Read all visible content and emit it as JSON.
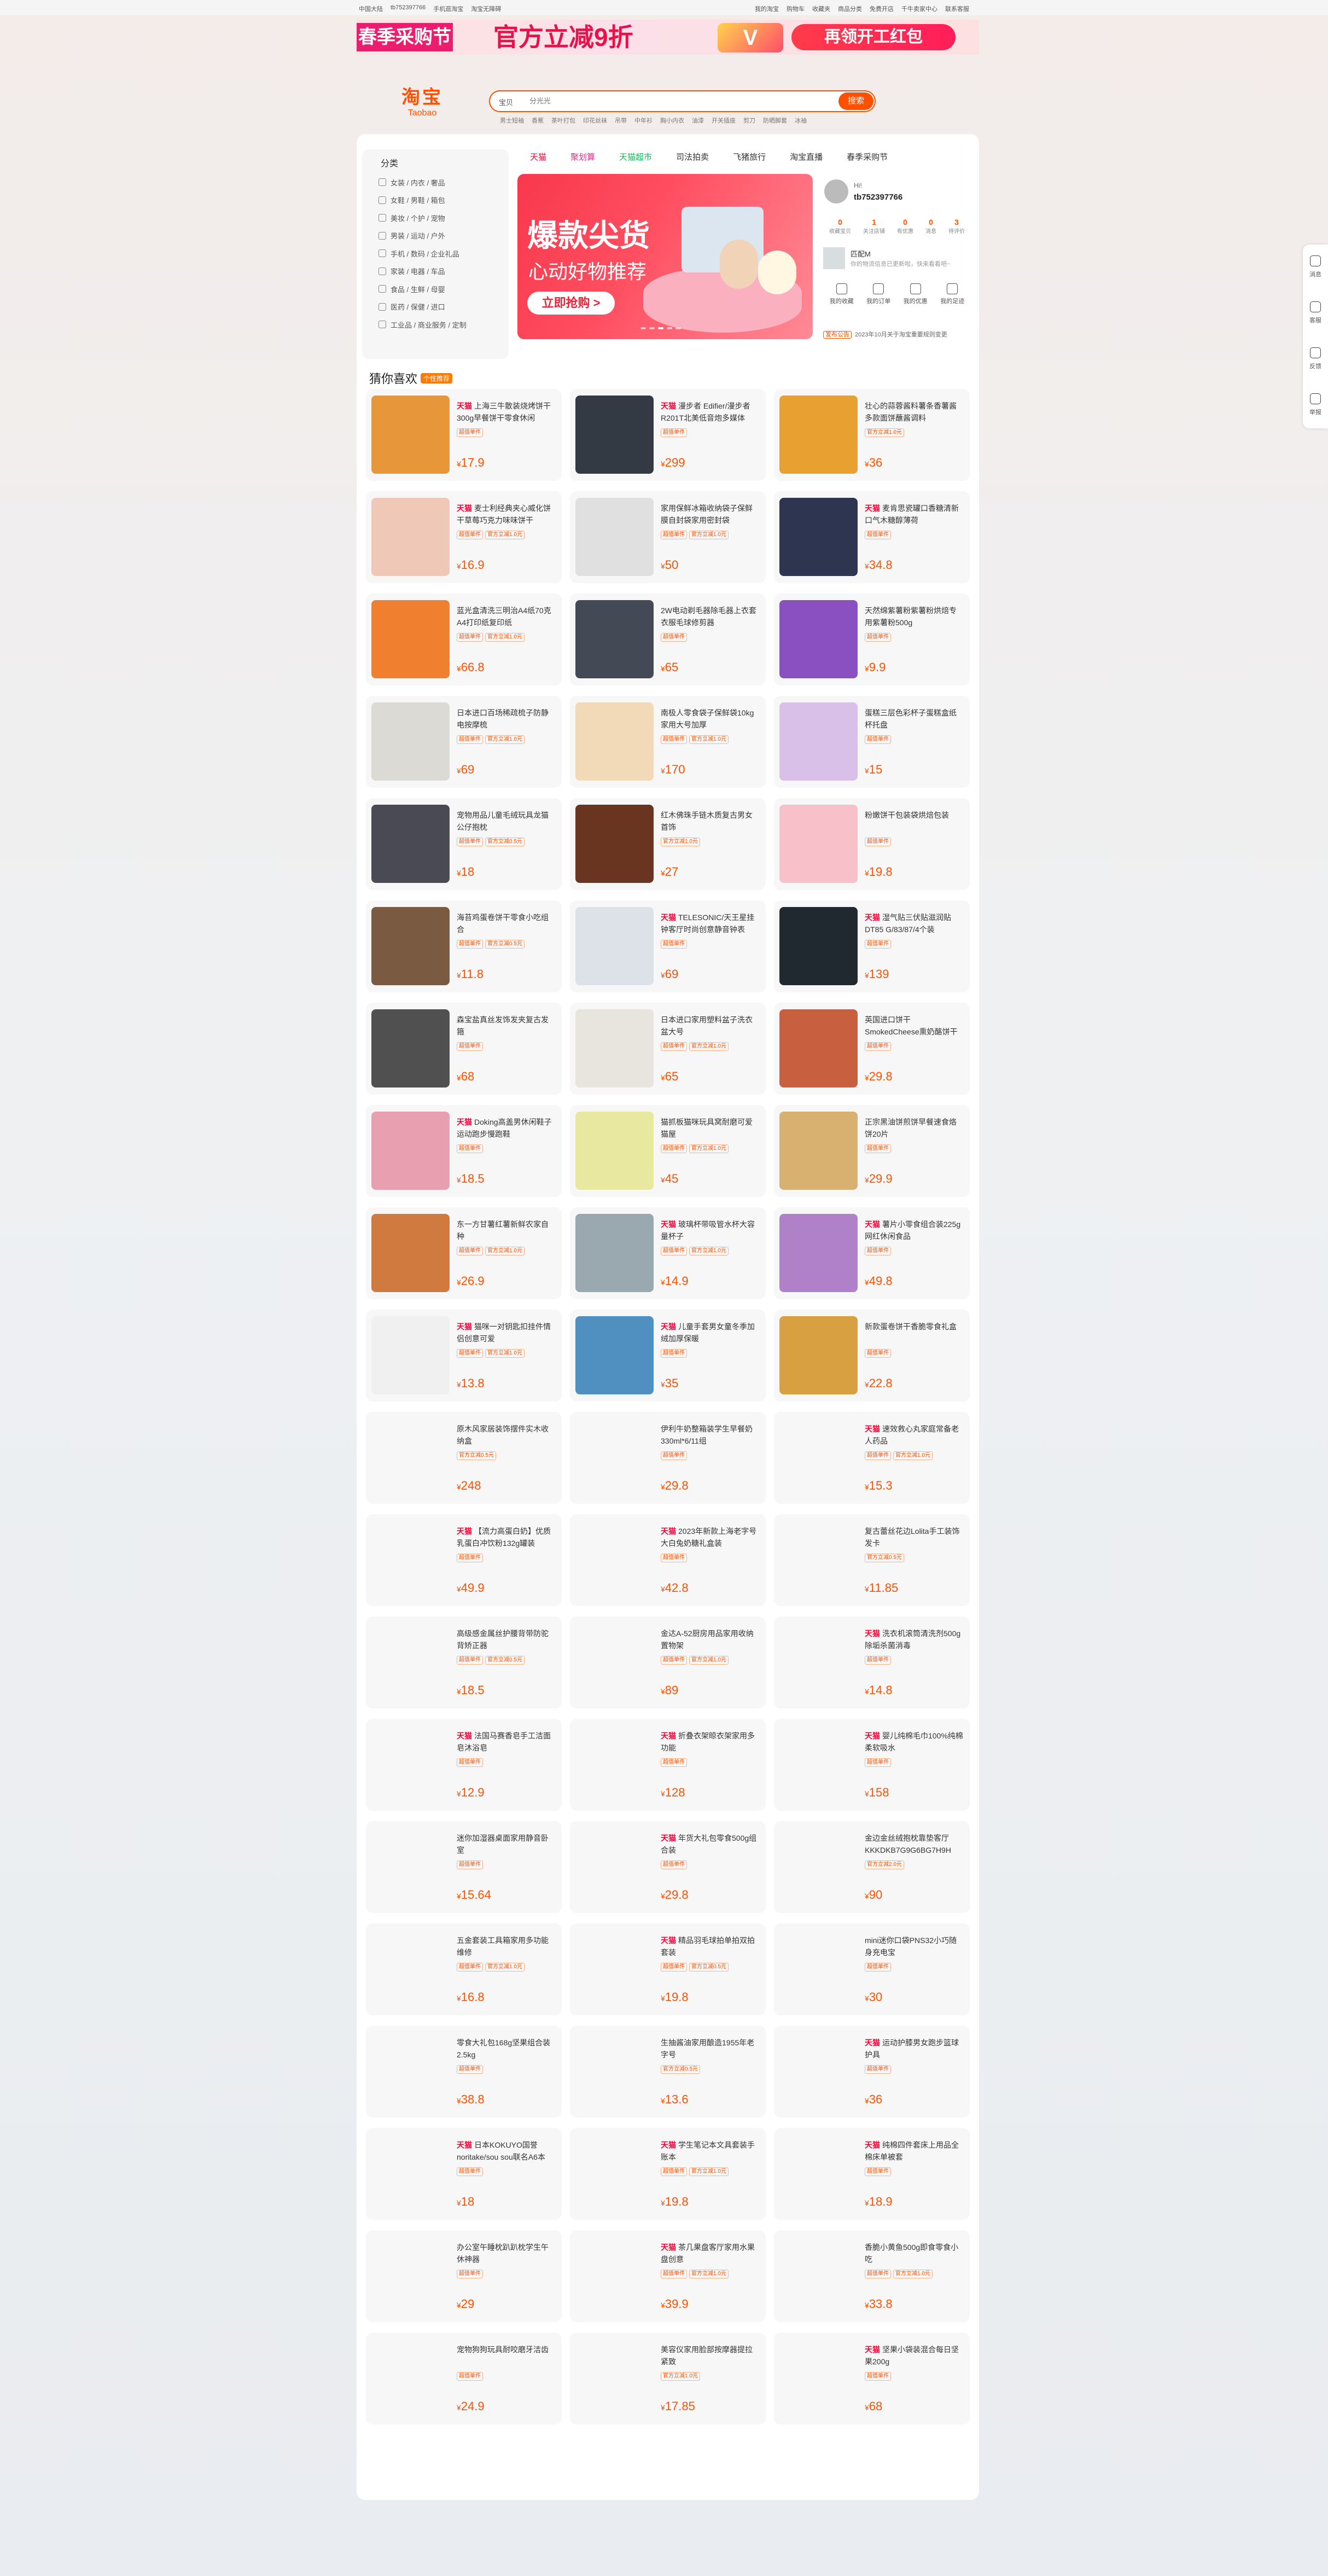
{
  "topbar": {
    "left": [
      "中国大陆",
      "tb752397766",
      "手机逛淘宝",
      "淘宝无障碍"
    ],
    "right": [
      "我的淘宝",
      "购物车",
      "收藏夹",
      "商品分类",
      "免费开店",
      "千牛卖家中心",
      "联系客服"
    ]
  },
  "banner": {
    "left": "春季采购节",
    "center": "官方立减9折",
    "v": "V",
    "cta": "再领开工红包"
  },
  "logo": {
    "main": "淘宝",
    "sub": "Taobao"
  },
  "search": {
    "category": "宝贝",
    "placeholder": "分光光",
    "button": "搜索"
  },
  "hot": [
    "男士短袖",
    "香蕉",
    "茶叶打包",
    "印花丝袜",
    "吊带",
    "中年衫",
    "胸小内衣",
    "油漆",
    "开关插座",
    "剪刀",
    "防晒脚套",
    "冰袖"
  ],
  "categories": {
    "title": "分类",
    "items": [
      "女装 / 内衣 / 奢品",
      "女鞋 / 男鞋 / 箱包",
      "美妆 / 个护 / 宠物",
      "男装 / 运动 / 户外",
      "手机 / 数码 / 企业礼品",
      "家装 / 电器 / 车品",
      "食品 / 生鲜 / 母婴",
      "医药 / 保健 / 进口",
      "工业品 / 商业服务 / 定制"
    ]
  },
  "tabs": [
    {
      "label": "天猫",
      "color": "#ff0036"
    },
    {
      "label": "聚划算",
      "color": "#e02e8a"
    },
    {
      "label": "天猫超市",
      "color": "#19b95d"
    },
    {
      "label": "司法拍卖",
      "color": "#333333"
    },
    {
      "label": "飞猪旅行",
      "color": "#333333"
    },
    {
      "label": "淘宝直播",
      "color": "#333333"
    },
    {
      "label": "春季采购节",
      "color": "#333333"
    }
  ],
  "hero": {
    "title": "爆款尖货",
    "subtitle": "心动好物推荐",
    "cta": "立即抢购 >"
  },
  "user": {
    "hi": "Hi!",
    "name": "tb752397766",
    "stats": [
      {
        "n": "0",
        "l": "收藏宝贝"
      },
      {
        "n": "1",
        "l": "关注店铺"
      },
      {
        "n": "0",
        "l": "有优惠"
      },
      {
        "n": "0",
        "l": "消息"
      },
      {
        "n": "3",
        "l": "待评价"
      }
    ],
    "fav_name": "匹配M",
    "fav_sub": "你的物流信息已更新啦，快来看看吧~",
    "actions": [
      "我的收藏",
      "我的订单",
      "我的优惠",
      "我的足迹"
    ],
    "ann_tag": "发布公告",
    "announcement": "2023年10月关于淘宝重要规则变更"
  },
  "guess": {
    "title": "猜你喜欢",
    "tag": "个性推荐"
  },
  "products": [
    {
      "tm": "天猫",
      "title": "上海三牛散装烧烤饼干300g早餐饼干零食休闲",
      "badges": [
        "超值单件"
      ],
      "price": "17.9",
      "img": "#e8963a"
    },
    {
      "tm": "天猫",
      "title": "漫步者 Edifier/漫步者 R201T北美低音炮多媒体",
      "badges": [
        "超值单件"
      ],
      "price": "299",
      "img": "#333a44"
    },
    {
      "tm": "",
      "title": "壮心的蒜蓉酱料薯条香薯酱多款面饼蘸酱调料",
      "badges": [
        "官方立减1.0元"
      ],
      "price": "36",
      "img": "#e8a030"
    },
    {
      "tm": "天猫",
      "title": "麦士利经典夹心威化饼干草莓巧克力味味饼干",
      "badges": [
        "超值单件",
        "官方立减1.0元"
      ],
      "price": "16.9",
      "img": "#f0c8b8"
    },
    {
      "tm": "",
      "title": "家用保鲜冰箱收纳袋子保鲜膜自封袋家用密封袋",
      "badges": [
        "超值单件",
        "官方立减1.0元"
      ],
      "price": "50",
      "img": "#e0e0e0"
    },
    {
      "tm": "天猫",
      "title": "麦肯思瓷罐口香糖清新口气木糖醇薄荷",
      "badges": [
        "超值单件"
      ],
      "price": "34.8",
      "img": "#2d3550"
    },
    {
      "tm": "",
      "title": "蓝光盒清洗三明治A4纸70克A4打印纸复印纸",
      "badges": [
        "超值单件",
        "官方立减1.0元"
      ],
      "price": "66.8",
      "img": "#f08030"
    },
    {
      "tm": "",
      "title": "2W电动剃毛器除毛器上衣套衣服毛球修剪器",
      "badges": [
        "超值单件"
      ],
      "price": "65",
      "img": "#444a55"
    },
    {
      "tm": "",
      "title": "天然绵紫薯粉紫薯粉烘焙专用紫薯粉500g",
      "badges": [
        "超值单件"
      ],
      "price": "9.9",
      "img": "#8a4fc0"
    },
    {
      "tm": "",
      "title": "日本进口百场稀疏梳子防静电按摩梳",
      "badges": [
        "超值单件",
        "官方立减1.0元"
      ],
      "price": "69",
      "img": "#dcdad5"
    },
    {
      "tm": "",
      "title": "南极人零食袋子保鲜袋10kg家用大号加厚",
      "badges": [
        "超值单件",
        "官方立减1.0元"
      ],
      "price": "170",
      "img": "#f2d9b8"
    },
    {
      "tm": "",
      "title": "蛋糕三层色彩杯子蛋糕盒纸杯托盘",
      "badges": [
        "超值单件"
      ],
      "price": "15",
      "img": "#d8c0e8"
    },
    {
      "tm": "",
      "title": "宠物用品儿童毛绒玩具龙猫公仔抱枕",
      "badges": [
        "超值单件",
        "官方立减0.5元"
      ],
      "price": "18",
      "img": "#4a4a55"
    },
    {
      "tm": "",
      "title": "红木佛珠手链木质复古男女首饰",
      "badges": [
        "官方立减1.0元"
      ],
      "price": "27",
      "img": "#6a3520"
    },
    {
      "tm": "",
      "title": "粉嫩饼干包装袋烘焙包装",
      "badges": [
        "超值单件"
      ],
      "price": "19.8",
      "img": "#f8c0c8"
    },
    {
      "tm": "",
      "title": "海苔鸡蛋卷饼干零食小吃组合",
      "badges": [
        "超值单件",
        "官方立减0.5元"
      ],
      "price": "11.8",
      "img": "#7a5a40"
    },
    {
      "tm": "天猫",
      "title": "TELESONIC/天王星挂钟客厅时尚创意静音钟表",
      "badges": [
        "超值单件"
      ],
      "price": "69",
      "img": "#dde2e8"
    },
    {
      "tm": "天猫",
      "title": "湿气贴三伏贴滋润贴DT85 G/83/87/4个装",
      "badges": [
        "超值单件"
      ],
      "price": "139",
      "img": "#202830"
    },
    {
      "tm": "",
      "title": "森宝盐真丝发饰发夹复古发箍",
      "badges": [
        "超值单件"
      ],
      "price": "68",
      "img": "#505050"
    },
    {
      "tm": "",
      "title": "日本进口家用塑料盆子洗衣盆大号",
      "badges": [
        "超值单件",
        "官方立减1.0元"
      ],
      "price": "65",
      "img": "#e8e4de"
    },
    {
      "tm": "",
      "title": "英国进口饼干SmokedCheese熏奶酪饼干",
      "badges": [
        "超值单件"
      ],
      "price": "29.8",
      "img": "#c86040"
    },
    {
      "tm": "天猫",
      "title": "Doking高盖男休闲鞋子运动跑步慢跑鞋",
      "badges": [
        "超值单件"
      ],
      "price": "18.5",
      "img": "#e8a0b0"
    },
    {
      "tm": "",
      "title": "猫抓板猫咪玩具窝耐磨可爱猫屋",
      "badges": [
        "超值单件",
        "官方立减1.0元"
      ],
      "price": "45",
      "img": "#e8e8a0"
    },
    {
      "tm": "",
      "title": "正宗黑油饼煎饼早餐速食烙饼20片",
      "badges": [
        "超值单件"
      ],
      "price": "29.9",
      "img": "#d8b070"
    },
    {
      "tm": "",
      "title": "东一方甘薯红薯新鲜农家自种",
      "badges": [
        "超值单件",
        "官方立减1.0元"
      ],
      "price": "26.9",
      "img": "#d07a40"
    },
    {
      "tm": "天猫",
      "title": "玻璃杯带吸管水杯大容量杯子",
      "badges": [
        "超值单件",
        "官方立减1.0元"
      ],
      "price": "14.9",
      "img": "#9aa8b0"
    },
    {
      "tm": "天猫",
      "title": "薯片小零食组合装225g网红休闲食品",
      "badges": [
        "超值单件"
      ],
      "price": "49.8",
      "img": "#b080c8"
    },
    {
      "tm": "天猫",
      "title": "猫咪一对钥匙扣挂件情侣创意可爱",
      "badges": [
        "超值单件",
        "官方立减1.0元"
      ],
      "price": "13.8",
      "img": "#f0f0f0"
    },
    {
      "tm": "天猫",
      "title": "儿童手套男女童冬季加绒加厚保暖",
      "badges": [
        "超值单件"
      ],
      "price": "35",
      "img": "#5090c0"
    },
    {
      "tm": "",
      "title": "新款蛋卷饼干香脆零食礼盒",
      "badges": [
        "超值单件"
      ],
      "price": "22.8",
      "img": "#d8a040"
    },
    {
      "tm": "",
      "title": "原木风家居装饰摆件实木收纳盒",
      "badges": [
        "官方立减0.5元"
      ],
      "price": "248",
      "img": "#f7f7f7"
    },
    {
      "tm": "",
      "title": "伊利牛奶整箱装学生早餐奶330ml*6/11组",
      "badges": [
        "超值单件"
      ],
      "price": "29.8",
      "img": "#f7f7f7"
    },
    {
      "tm": "天猫",
      "title": "速效救心丸家庭常备老人药品",
      "badges": [
        "超值单件",
        "官方立减1.0元"
      ],
      "price": "15.3",
      "img": "#f7f7f7"
    },
    {
      "tm": "天猫",
      "title": "【流力高蛋白奶】优质乳蛋白冲饮粉132g罐装",
      "badges": [
        "超值单件"
      ],
      "price": "49.9",
      "img": "#f7f7f7"
    },
    {
      "tm": "天猫",
      "title": "2023年新款上海老字号大白兔奶糖礼盒装",
      "badges": [
        "超值单件"
      ],
      "price": "42.8",
      "img": "#f7f7f7"
    },
    {
      "tm": "",
      "title": "复古蕾丝花边Lolita手工装饰发卡",
      "badges": [
        "官方立减0.5元"
      ],
      "price": "11.85",
      "img": "#f7f7f7"
    },
    {
      "tm": "",
      "title": "高级感金属丝护腰背带防驼背矫正器",
      "badges": [
        "超值单件",
        "官方立减0.5元"
      ],
      "price": "18.5",
      "img": "#f7f7f7"
    },
    {
      "tm": "",
      "title": "金达A-52厨房用品家用收纳置物架",
      "badges": [
        "超值单件",
        "官方立减1.0元"
      ],
      "price": "89",
      "img": "#f7f7f7"
    },
    {
      "tm": "天猫",
      "title": "洗衣机滚筒清洗剂500g除垢杀菌消毒",
      "badges": [
        "超值单件"
      ],
      "price": "14.8",
      "img": "#f7f7f7"
    },
    {
      "tm": "天猫",
      "title": "法国马赛香皂手工洁面皂沐浴皂",
      "badges": [
        "超值单件"
      ],
      "price": "12.9",
      "img": "#f7f7f7"
    },
    {
      "tm": "天猫",
      "title": "折叠衣架晾衣架家用多功能",
      "badges": [
        "超值单件"
      ],
      "price": "128",
      "img": "#f7f7f7"
    },
    {
      "tm": "天猫",
      "title": "婴儿纯棉毛巾100%纯棉柔软吸水",
      "badges": [
        "超值单件"
      ],
      "price": "158",
      "img": "#f7f7f7"
    },
    {
      "tm": "",
      "title": "迷你加湿器桌面家用静音卧室",
      "badges": [
        "超值单件"
      ],
      "price": "15.64",
      "img": "#f7f7f7"
    },
    {
      "tm": "天猫",
      "title": "年货大礼包零食500g组合装",
      "badges": [
        "超值单件"
      ],
      "price": "29.8",
      "img": "#f7f7f7"
    },
    {
      "tm": "",
      "title": "金边金丝绒抱枕靠垫客厅KKKDKB7G9G6BG7H9H",
      "badges": [
        "官方立减2.0元"
      ],
      "price": "90",
      "img": "#f7f7f7"
    },
    {
      "tm": "",
      "title": "五金套装工具箱家用多功能维修",
      "badges": [
        "超值单件",
        "官方立减1.0元"
      ],
      "price": "16.8",
      "img": "#f7f7f7"
    },
    {
      "tm": "天猫",
      "title": "精品羽毛球拍单拍双拍套装",
      "badges": [
        "超值单件",
        "官方立减0.5元"
      ],
      "price": "19.8",
      "img": "#f7f7f7"
    },
    {
      "tm": "",
      "title": "mini迷你口袋PNS32小巧随身充电宝",
      "badges": [
        "超值单件"
      ],
      "price": "30",
      "img": "#f7f7f7"
    },
    {
      "tm": "",
      "title": "零食大礼包168g坚果组合装2.5kg",
      "badges": [
        "超值单件"
      ],
      "price": "38.8",
      "img": "#f7f7f7"
    },
    {
      "tm": "",
      "title": "生抽酱油家用酿造1955年老字号",
      "badges": [
        "官方立减0.5元"
      ],
      "price": "13.6",
      "img": "#f7f7f7"
    },
    {
      "tm": "天猫",
      "title": "运动护膝男女跑步篮球护具",
      "badges": [
        "超值单件"
      ],
      "price": "36",
      "img": "#f7f7f7"
    },
    {
      "tm": "天猫",
      "title": "日本KOKUYO国誉noritake/sou sou联名A6本",
      "badges": [
        "超值单件"
      ],
      "price": "18",
      "img": "#f7f7f7"
    },
    {
      "tm": "天猫",
      "title": "学生笔记本文具套装手账本",
      "badges": [
        "超值单件",
        "官方立减1.0元"
      ],
      "price": "19.8",
      "img": "#f7f7f7"
    },
    {
      "tm": "天猫",
      "title": "纯棉四件套床上用品全棉床单被套",
      "badges": [
        "超值单件"
      ],
      "price": "18.9",
      "img": "#f7f7f7"
    },
    {
      "tm": "",
      "title": "办公室午睡枕趴趴枕学生午休神器",
      "badges": [
        "超值单件"
      ],
      "price": "29",
      "img": "#f7f7f7"
    },
    {
      "tm": "天猫",
      "title": "茶几果盘客厅家用水果盘创意",
      "badges": [
        "超值单件",
        "官方立减1.0元"
      ],
      "price": "39.9",
      "img": "#f7f7f7"
    },
    {
      "tm": "",
      "title": "香脆小黄鱼500g即食零食小吃",
      "badges": [
        "超值单件",
        "官方立减1.0元"
      ],
      "price": "33.8",
      "img": "#f7f7f7"
    },
    {
      "tm": "",
      "title": "宠物狗狗玩具耐咬磨牙洁齿",
      "badges": [
        "超值单件"
      ],
      "price": "24.9",
      "img": "#f7f7f7"
    },
    {
      "tm": "",
      "title": "美容仪家用脸部按摩器提拉紧致",
      "badges": [
        "官方立减1.0元"
      ],
      "price": "17.85",
      "img": "#f7f7f7"
    },
    {
      "tm": "天猫",
      "title": "坚果小袋装混合每日坚果200g",
      "badges": [
        "超值单件"
      ],
      "price": "68",
      "img": "#f7f7f7"
    }
  ],
  "sidebar": [
    "消息",
    "客服",
    "反馈",
    "举报"
  ],
  "colors": {
    "brand": "#ff5000",
    "tmall": "#ff0036"
  }
}
